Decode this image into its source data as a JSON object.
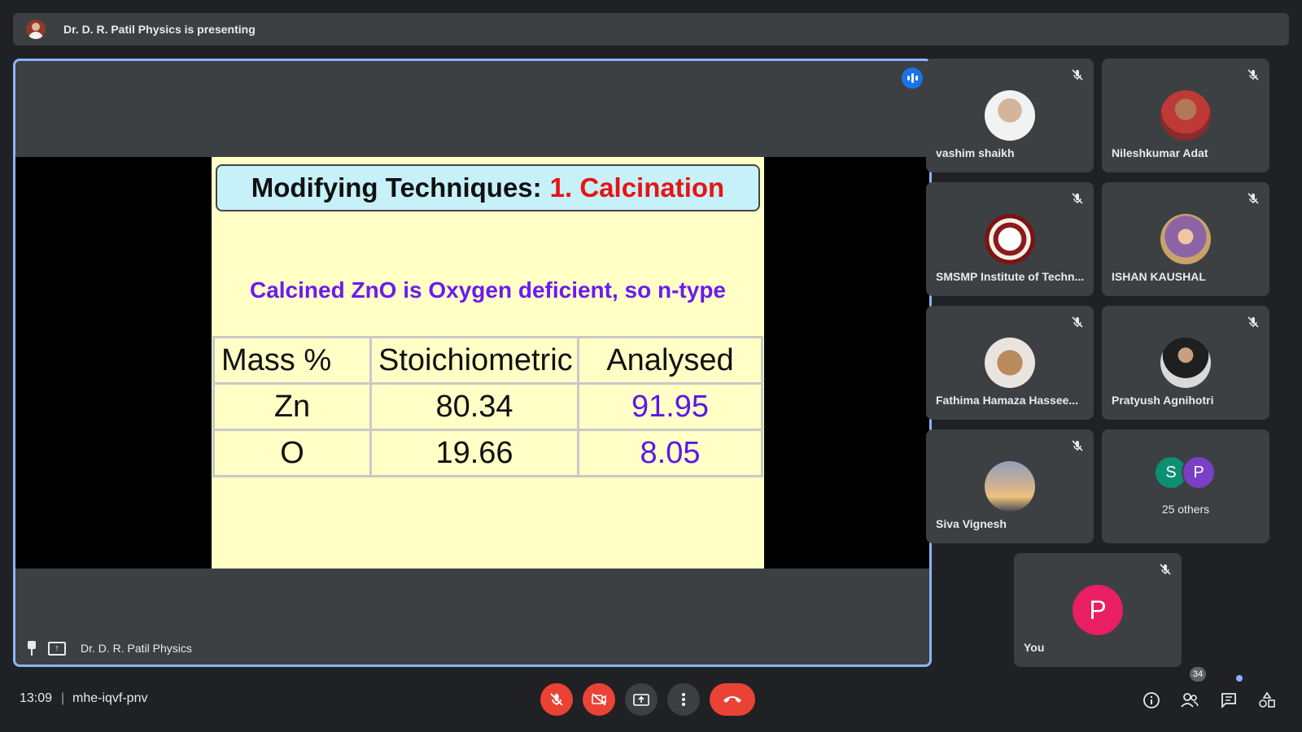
{
  "presenting_bar": {
    "text": "Dr. D. R. Patil Physics is presenting"
  },
  "main_tile": {
    "presenter_name": "Dr. D. R. Patil Physics",
    "slide": {
      "title_black": "Modifying Techniques:",
      "title_red": "1. Calcination",
      "subtitle": "Calcined ZnO is Oxygen deficient, so n-type",
      "table": {
        "headers": [
          "Mass %",
          "Stoichiometric",
          "Analysed"
        ],
        "rows": [
          [
            "Zn",
            "80.34",
            "91.95"
          ],
          [
            "O",
            "19.66",
            "8.05"
          ]
        ]
      }
    }
  },
  "participants": [
    {
      "name": "vashim shaikh",
      "avatar": "photo"
    },
    {
      "name": "Nileshkumar Adat",
      "avatar": "photo"
    },
    {
      "name": "SMSMP Institute of Techn...",
      "avatar": "logo"
    },
    {
      "name": "ISHAN KAUSHAL",
      "avatar": "photo"
    },
    {
      "name": "Fathima Hamaza Hassee...",
      "avatar": "photo"
    },
    {
      "name": "Pratyush Agnihotri",
      "avatar": "photo"
    },
    {
      "name": "Siva Vignesh",
      "avatar": "photo"
    }
  ],
  "others_tile": {
    "initials": [
      "S",
      "P"
    ],
    "label": "25 others"
  },
  "you_tile": {
    "initial": "P",
    "label": "You"
  },
  "bottom_bar": {
    "time": "13:09",
    "separator": "|",
    "meeting_code": "mhe-iqvf-pnv",
    "people_count": "34"
  },
  "colors": {
    "background": "#202124",
    "tile": "#3c4043",
    "active_border": "#8ab4f8",
    "danger": "#ea4335",
    "you_avatar": "#e91e63"
  }
}
